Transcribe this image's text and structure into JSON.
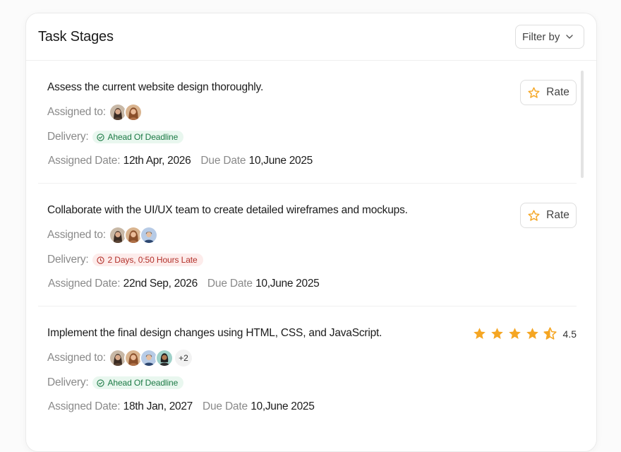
{
  "header": {
    "title": "Task Stages",
    "filter_label": "Filter by"
  },
  "labels": {
    "assigned": "Assigned to:",
    "delivery": "Delivery:",
    "assigned_date": "Assigned Date:",
    "due_date": "Due Date"
  },
  "colors": {
    "star": "#f5a623",
    "ok_text": "#1c7a45",
    "ok_bg": "#e9f7ef",
    "late_text": "#b2302a",
    "late_bg": "#fdeceb"
  },
  "tasks": [
    {
      "title": "Assess the current website design thoroughly.",
      "avatars": [
        "avatar-1",
        "avatar-2"
      ],
      "delivery_status": "ok",
      "delivery": "Ahead Of Deadline",
      "assigned_date": "12th Apr, 2026",
      "due_date": "10,June 2025",
      "rate_label": "Rate"
    },
    {
      "title": "Collaborate with the UI/UX team to create detailed wireframes and mockups.",
      "avatars": [
        "avatar-1",
        "avatar-2",
        "avatar-3"
      ],
      "delivery_status": "late",
      "delivery": "2 Days, 0:50 Hours Late",
      "assigned_date": "22nd Sep, 2026",
      "due_date": "10,June 2025",
      "rate_label": "Rate"
    },
    {
      "title": "Implement the final design changes using HTML, CSS, and JavaScript.",
      "avatars": [
        "avatar-1",
        "avatar-2",
        "avatar-3",
        "avatar-4"
      ],
      "more_count": "+2",
      "delivery_status": "ok",
      "delivery": "Ahead Of Deadline",
      "assigned_date": "18th Jan, 2027",
      "due_date": "10,June 2025",
      "rating": "4.5",
      "rating_value": 4.5,
      "rating_max": 5
    }
  ]
}
